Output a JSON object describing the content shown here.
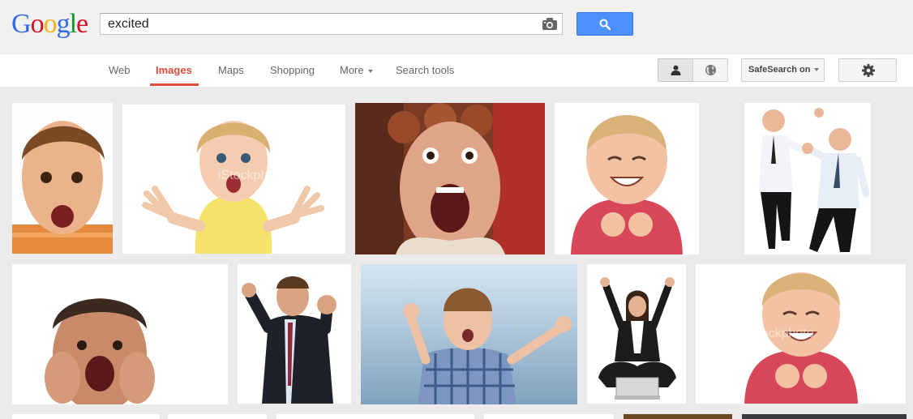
{
  "logo": {
    "letters": [
      "G",
      "o",
      "o",
      "g",
      "l",
      "e"
    ],
    "colors": [
      "#3369e8",
      "#d50f25",
      "#eeb211",
      "#3369e8",
      "#009925",
      "#d50f25"
    ]
  },
  "search": {
    "query": "excited"
  },
  "tabs": [
    {
      "label": "Web",
      "active": false
    },
    {
      "label": "Images",
      "active": true
    },
    {
      "label": "Maps",
      "active": false
    },
    {
      "label": "Shopping",
      "active": false
    },
    {
      "label": "More",
      "active": false
    },
    {
      "label": "Search tools",
      "active": false
    }
  ],
  "toolbar": {
    "safesearch_label": "SafeSearch on"
  },
  "colors": {
    "accent": "#dd4b39",
    "search_button": "#4d90fe"
  },
  "results": {
    "watermark": "iStockphoto",
    "row1": [
      {
        "name": "toddler-boy-surprised"
      },
      {
        "name": "girl-yellow-dress-hands-up"
      },
      {
        "name": "woman-hair-rollers-screaming"
      },
      {
        "name": "girl-fists-smiling"
      },
      {
        "name": "two-businessmen-high-five"
      }
    ],
    "row2": [
      {
        "name": "boy-hands-on-cheeks"
      },
      {
        "name": "businessman-fist-pump"
      },
      {
        "name": "boy-plaid-shirt-celebrating"
      },
      {
        "name": "woman-laptop-arms-up"
      },
      {
        "name": "girl-fists-smiling-2"
      }
    ]
  }
}
